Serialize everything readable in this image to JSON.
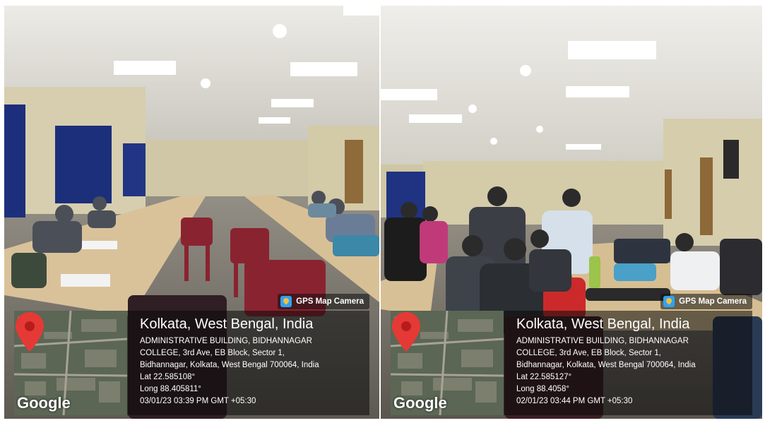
{
  "photos": [
    {
      "badge": "GPS Map Camera",
      "map_brand": "Google",
      "location": "Kolkata, West Bengal, India",
      "address_line1": "ADMINISTRATIVE BUILDING, BIDHANNAGAR",
      "address_line2": "COLLEGE, 3rd Ave, EB Block, Sector 1,",
      "address_line3": "Bidhannagar, Kolkata, West Bengal 700064, India",
      "lat": "Lat 22.585108°",
      "long": "Long 88.405811°",
      "datetime": "03/01/23 03:39 PM GMT +05:30"
    },
    {
      "badge": "GPS Map Camera",
      "map_brand": "Google",
      "location": "Kolkata, West Bengal, India",
      "address_line1": "ADMINISTRATIVE BUILDING, BIDHANNAGAR",
      "address_line2": "COLLEGE, 3rd Ave, EB Block, Sector 1,",
      "address_line3": "Bidhannagar, Kolkata, West Bengal 700064, India",
      "lat": "Lat 22.585127°",
      "long": "Long 88.4058°",
      "datetime": "02/01/23 03:44 PM GMT +05:30"
    }
  ],
  "colors": {
    "pin": "#e53935",
    "overlay": "#0a0a0a",
    "curtain": "#1c2f7a",
    "ceiling": "#e8e6e0",
    "wall": "#d8cfae",
    "table": "#d9c29a"
  }
}
